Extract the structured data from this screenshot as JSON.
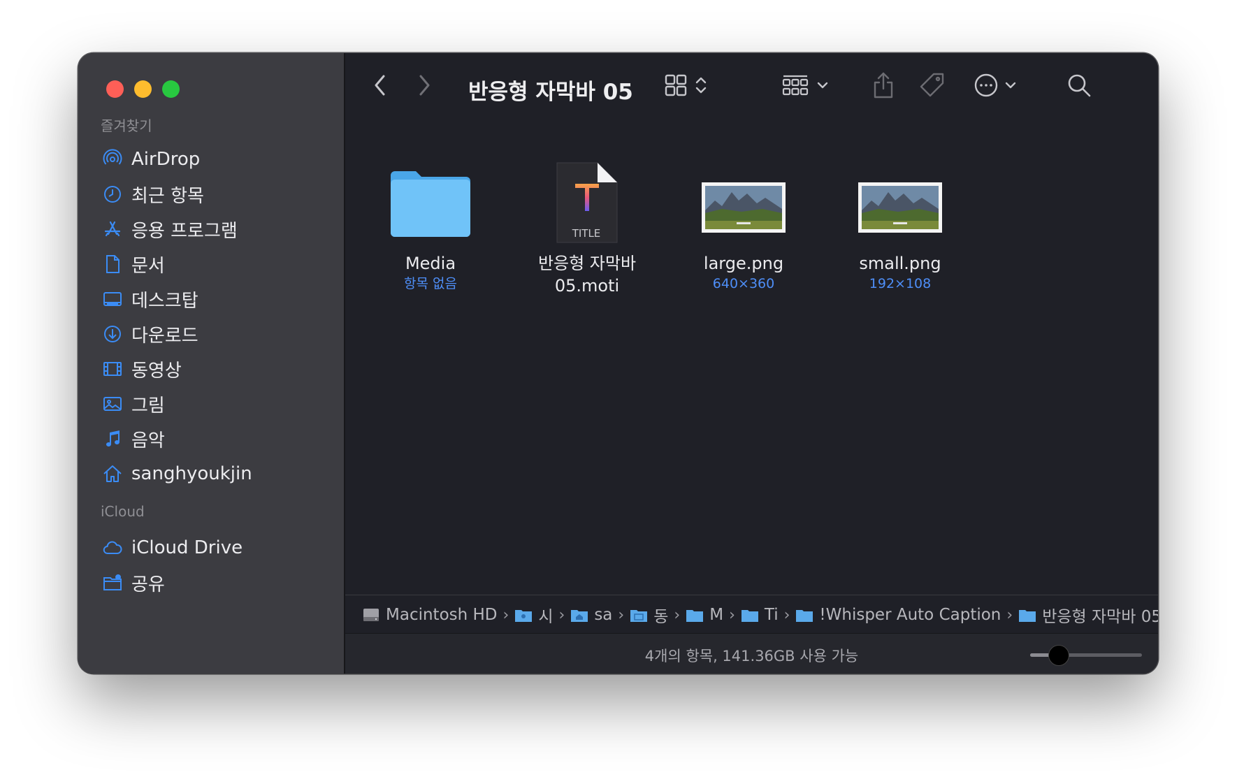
{
  "window": {
    "title": "반응형 자막바 05"
  },
  "sidebar": {
    "favorites_title": "즐겨찾기",
    "favorites": [
      {
        "label": "AirDrop",
        "icon": "airdrop-icon"
      },
      {
        "label": "최근 항목",
        "icon": "clock-icon"
      },
      {
        "label": "응용 프로그램",
        "icon": "applications-icon"
      },
      {
        "label": "문서",
        "icon": "document-icon"
      },
      {
        "label": "데스크탑",
        "icon": "desktop-icon"
      },
      {
        "label": "다운로드",
        "icon": "download-icon"
      },
      {
        "label": "동영상",
        "icon": "film-icon"
      },
      {
        "label": "그림",
        "icon": "photo-icon"
      },
      {
        "label": "음악",
        "icon": "music-note-icon"
      },
      {
        "label": "sanghyoukjin",
        "icon": "home-icon"
      }
    ],
    "icloud_title": "iCloud",
    "icloud": [
      {
        "label": "iCloud Drive",
        "icon": "cloud-icon"
      },
      {
        "label": "공유",
        "icon": "shared-folder-icon"
      }
    ]
  },
  "files": [
    {
      "name": "Media",
      "sub": "항목 없음",
      "kind": "folder"
    },
    {
      "name": "반응형 자막바 05.moti",
      "line1": "반응형 자막바",
      "line2": "05.moti",
      "badge": "TITLE",
      "kind": "motion-title"
    },
    {
      "name": "large.png",
      "sub": "640×360",
      "kind": "image"
    },
    {
      "name": "small.png",
      "sub": "192×108",
      "kind": "image"
    }
  ],
  "pathbar": {
    "crumbs": [
      "Macintosh HD",
      "시",
      "sa",
      "동",
      "M",
      "Ti",
      "!Whisper Auto Caption",
      "반응형 자막바 05"
    ]
  },
  "status": {
    "text": "4개의 항목, 141.36GB 사용 가능",
    "zoom_level": 0.25
  },
  "colors": {
    "accent": "#4e8ef7",
    "folder": "#70c3f8",
    "sidebar_bg": "#3c3c41",
    "content_bg": "#1f2027"
  }
}
